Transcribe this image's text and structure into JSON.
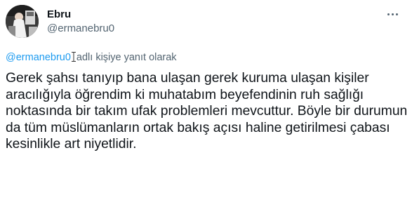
{
  "author": {
    "display_name": "Ebru",
    "handle": "@ermanebru0",
    "avatar_icon": "profile-photo"
  },
  "more_icon": "ellipsis-icon",
  "reply_context": {
    "mention": "@ermanebru0",
    "suffix": "adlı kişiye yanıt olarak"
  },
  "tweet": {
    "text": "Gerek şahsı tanıyıp bana ulaşan gerek kuruma ulaşan kişiler aracılığıyla öğrendim ki muhatabım beyefendinin ruh sağlığı noktasında bir takım ufak problemleri mevcuttur. Böyle bir durumun da tüm müslümanların ortak bakış açısı haline getirilmesi çabası kesinlikle art niyetlidir."
  },
  "colors": {
    "text_primary": "#0f1419",
    "text_secondary": "#536471",
    "link": "#1d9bf0",
    "background": "#ffffff"
  }
}
